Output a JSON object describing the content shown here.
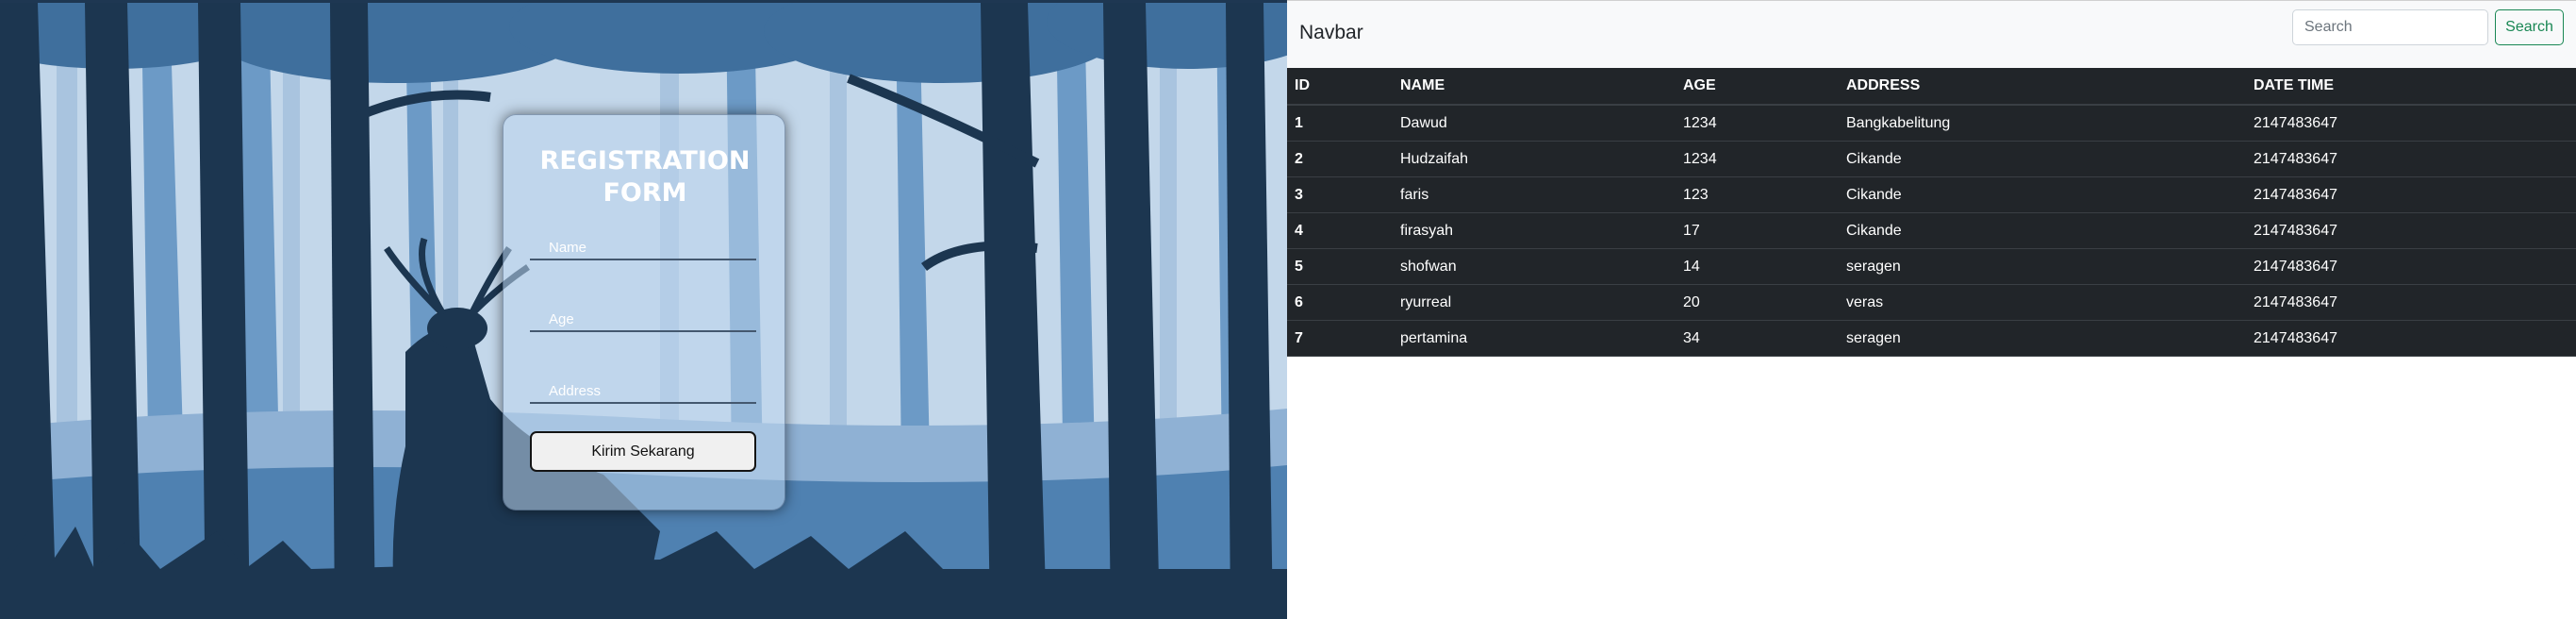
{
  "form": {
    "title_line1": "REGISTRATION",
    "title_line2": "FORM",
    "name_placeholder": "Name",
    "age_placeholder": "Age",
    "address_placeholder": "Address",
    "submit_label": "Kirim Sekarang"
  },
  "navbar": {
    "brand": "Navbar",
    "search_placeholder": "Search",
    "search_button": "Search"
  },
  "table": {
    "headers": [
      "ID",
      "NAME",
      "AGE",
      "ADDRESS",
      "DATE TIME"
    ],
    "rows": [
      {
        "id": "1",
        "name": "Dawud",
        "age": "1234",
        "address": "Bangkabelitung",
        "datetime": "2147483647"
      },
      {
        "id": "2",
        "name": "Hudzaifah",
        "age": "1234",
        "address": "Cikande",
        "datetime": "2147483647"
      },
      {
        "id": "3",
        "name": "faris",
        "age": "123",
        "address": "Cikande",
        "datetime": "2147483647"
      },
      {
        "id": "4",
        "name": "firasyah",
        "age": "17",
        "address": "Cikande",
        "datetime": "2147483647"
      },
      {
        "id": "5",
        "name": "shofwan",
        "age": "14",
        "address": "seragen",
        "datetime": "2147483647"
      },
      {
        "id": "6",
        "name": "ryurreal",
        "age": "20",
        "address": "veras",
        "datetime": "2147483647"
      },
      {
        "id": "7",
        "name": "pertamina",
        "age": "34",
        "address": "seragen",
        "datetime": "2147483647"
      }
    ]
  },
  "colors": {
    "table_bg": "#212529",
    "search_accent": "#198754",
    "navbar_bg": "#f8f9fa",
    "sky": "#c3d7ea",
    "forest_dark": "#1c3650"
  }
}
